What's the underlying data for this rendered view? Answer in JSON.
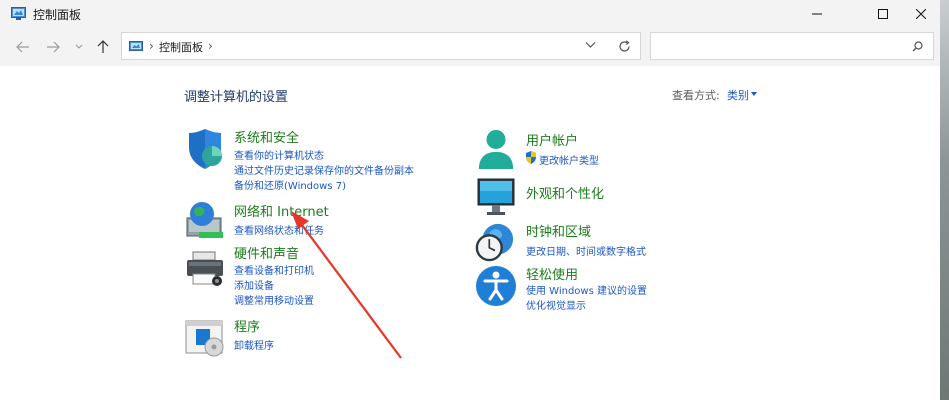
{
  "window": {
    "title": "控制面板",
    "controls": {
      "minimize": "minimize",
      "maximize": "maximize",
      "close": "close"
    }
  },
  "nav": {
    "address_separator": "›",
    "address_text": "控制面板",
    "address_separator2": "›",
    "search_placeholder": ""
  },
  "main": {
    "heading": "调整计算机的设置",
    "view_by_label": "查看方式:",
    "view_by_value": "类别"
  },
  "categories": [
    {
      "title": "系统和安全",
      "icon": "shield-icon",
      "links": [
        "查看你的计算机状态",
        "通过文件历史记录保存你的文件备份副本",
        "备份和还原(Windows 7)"
      ]
    },
    {
      "title": "网络和 Internet",
      "icon": "network-globe-icon",
      "links": [
        "查看网络状态和任务"
      ]
    },
    {
      "title": "硬件和声音",
      "icon": "printer-icon",
      "links": [
        "查看设备和打印机",
        "添加设备",
        "调整常用移动设置"
      ]
    },
    {
      "title": "程序",
      "icon": "programs-icon",
      "links": [
        "卸载程序"
      ]
    },
    {
      "title": "用户帐户",
      "icon": "user-icon",
      "links": [
        "更改帐户类型"
      ]
    },
    {
      "title": "外观和个性化",
      "icon": "monitor-icon",
      "links": []
    },
    {
      "title": "时钟和区域",
      "icon": "clock-globe-icon",
      "links": [
        "更改日期、时间或数字格式"
      ]
    },
    {
      "title": "轻松使用",
      "icon": "accessibility-icon",
      "links": [
        "使用 Windows 建议的设置",
        "优化视觉显示"
      ]
    }
  ],
  "colors": {
    "category_title": "#1a7d1a",
    "link": "#1c57c4",
    "heading": "#1e3b6b",
    "annotation_arrow": "#e8352b"
  }
}
